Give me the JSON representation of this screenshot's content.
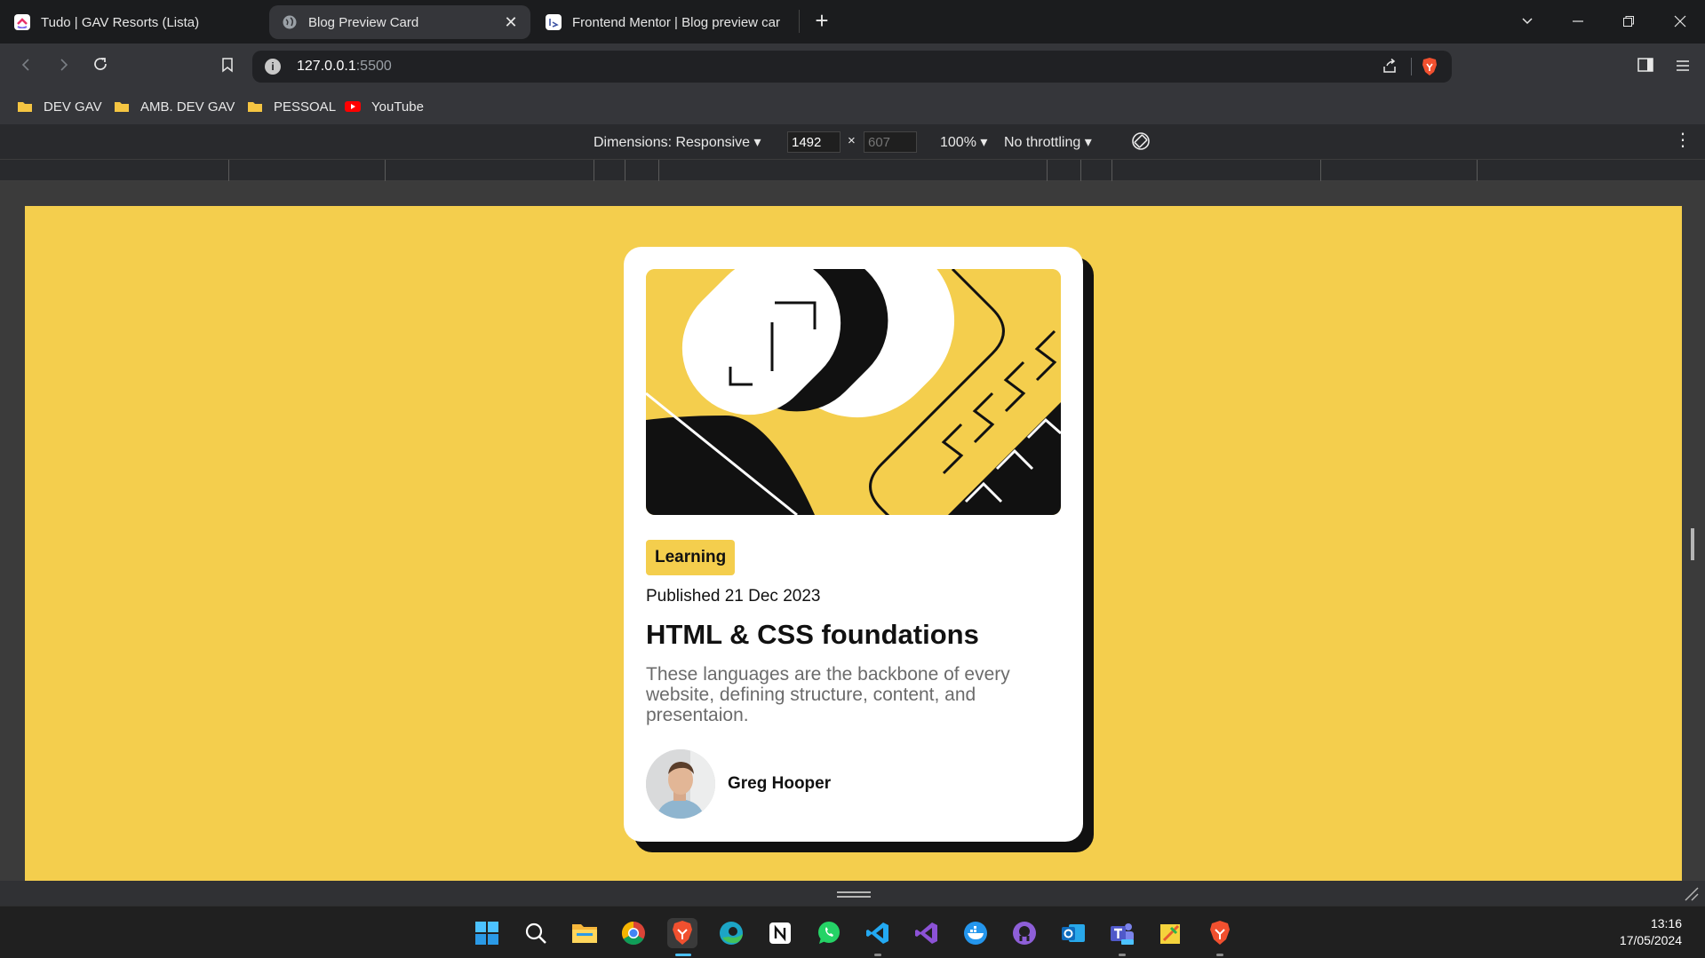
{
  "browser": {
    "tabs": [
      {
        "title": "Tudo | GAV Resorts (Lista)",
        "active": false
      },
      {
        "title": "Blog Preview Card",
        "active": true
      },
      {
        "title": "Frontend Mentor | Blog preview card",
        "active": false
      }
    ],
    "address": {
      "host": "127.0.0.1",
      "port": ":5500"
    },
    "bookmarks": [
      {
        "label": "DEV GAV",
        "icon": "folder-icon"
      },
      {
        "label": "AMB. DEV GAV",
        "icon": "folder-icon"
      },
      {
        "label": "PESSOAL",
        "icon": "folder-icon"
      },
      {
        "label": "YouTube",
        "icon": "youtube-icon"
      }
    ]
  },
  "devtools": {
    "dimensions_label": "Dimensions: Responsive",
    "width": "1492",
    "height_placeholder": "607",
    "times": "×",
    "zoom": "100%",
    "throttling": "No throttling"
  },
  "card": {
    "tag": "Learning",
    "published": "Published 21 Dec 2023",
    "title": "HTML & CSS foundations",
    "description": "These languages are the backbone of every website, defining structure, content, and presentaion.",
    "author": "Greg Hooper"
  },
  "taskbar": {
    "time": "13:16",
    "date": "17/05/2024"
  },
  "colors": {
    "accent_yellow": "#f4ce4d",
    "card_bg": "#ffffff",
    "ink": "#111111",
    "muted_text": "#6b6b6b"
  }
}
